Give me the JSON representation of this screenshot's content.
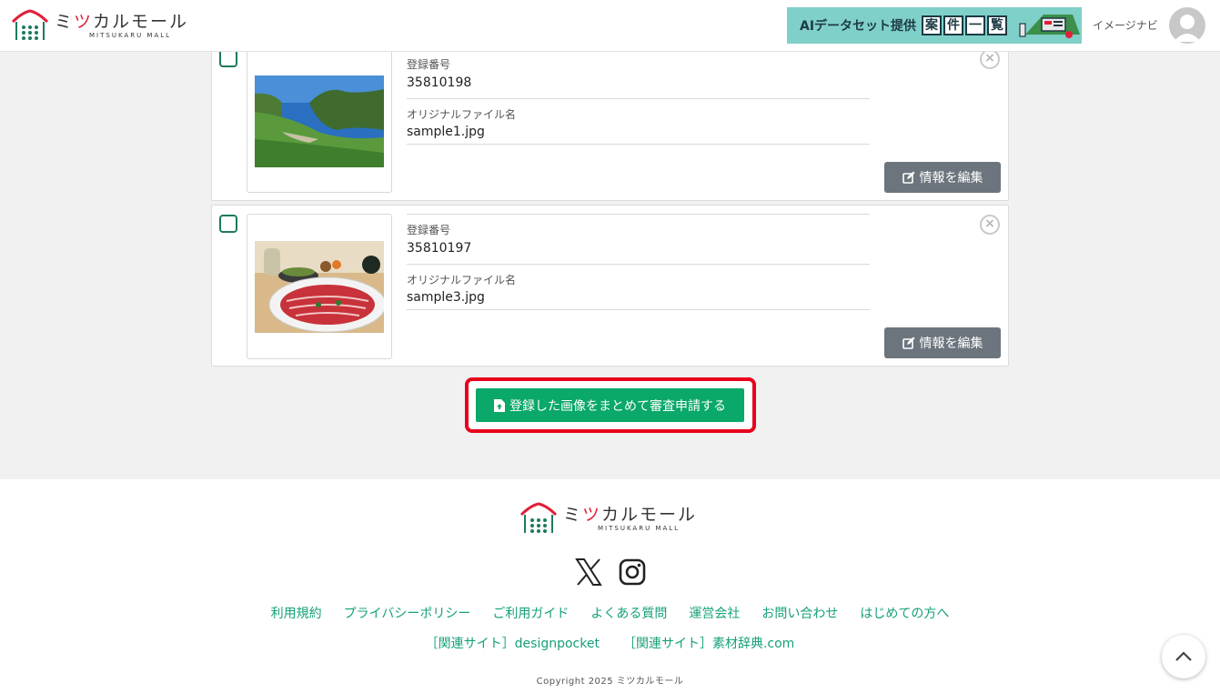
{
  "header": {
    "logo_title_pre": "ミ",
    "logo_title_red": "ツ",
    "logo_title_post": "カルモール",
    "logo_sub": "MITSUKARU MALL",
    "banner_text": "AIデータセット提供",
    "banner_kanji": [
      "案",
      "件",
      "一",
      "覧"
    ],
    "user_name": "イメージナビ"
  },
  "items": [
    {
      "reg_label": "登録番号",
      "reg_number": "35810198",
      "file_label": "オリジナルファイル名",
      "file_name": "sample1.jpg",
      "edit_label": "情報を編集"
    },
    {
      "reg_label": "登録番号",
      "reg_number": "35810197",
      "file_label": "オリジナルファイル名",
      "file_name": "sample3.jpg",
      "edit_label": "情報を編集"
    }
  ],
  "submit_label": "登録した画像をまとめて審査申請する",
  "footer": {
    "logo_title_pre": "ミ",
    "logo_title_red": "ツ",
    "logo_title_post": "カルモール",
    "logo_sub": "MITSUKARU MALL",
    "links": [
      "利用規約",
      "プライバシーポリシー",
      "ご利用ガイド",
      "よくある質問",
      "運営会社",
      "お問い合わせ",
      "はじめての方へ"
    ],
    "related": [
      "［関連サイト］designpocket",
      "［関連サイト］素材辞典.com"
    ],
    "copyright": "Copyright 2025 ミツカルモール"
  },
  "colors": {
    "accent_green": "#0aa869",
    "highlight_red": "#e8001c",
    "edit_gray": "#6c757d",
    "link_green": "#15a07a"
  }
}
